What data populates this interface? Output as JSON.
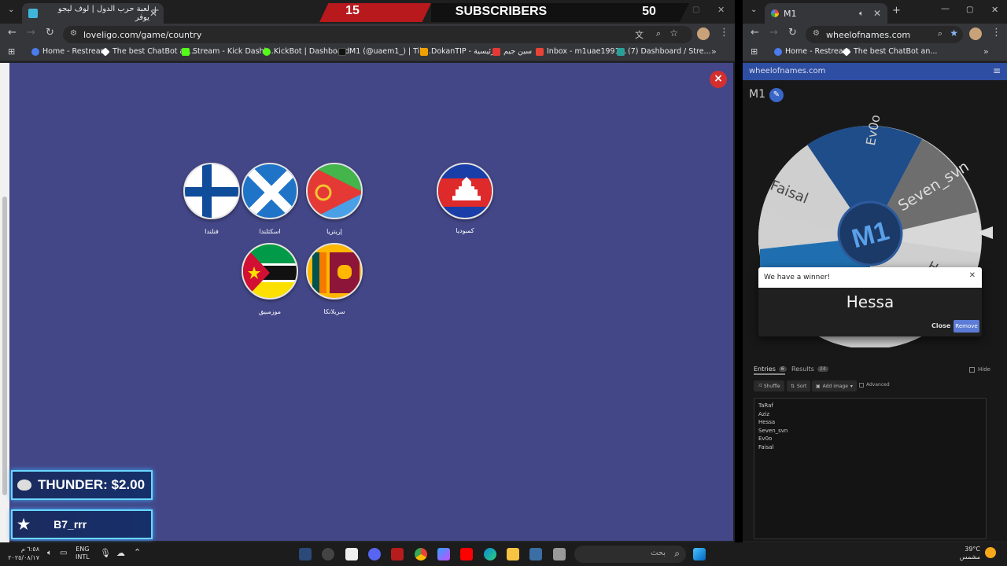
{
  "stream_overlay": {
    "left_count": "15",
    "title": "SUBSCRIBERS",
    "right_count": "50"
  },
  "left_browser": {
    "tab_title": "لعبة حرب الدول | لوف ليجو يوفر",
    "url": "loveligo.com/game/country",
    "bookmarks": [
      {
        "label": "Home - Restream",
        "color": "#4b7bec"
      },
      {
        "label": "The best ChatBot an...",
        "color": "#ffffff"
      },
      {
        "label": "Stream - Kick Dashb...",
        "color": "#53fc18"
      },
      {
        "label": "KickBot | Dashboard",
        "color": "#53fc18"
      },
      {
        "label": "M1 (@uaem1_) | Tik...",
        "color": "#000000"
      },
      {
        "label": "DokanTIP - الرئيسية",
        "color": "#f0a000"
      },
      {
        "label": "سين جيم",
        "color": "#e53935"
      },
      {
        "label": "Inbox - m1uae1991...",
        "color": "#ea4335"
      },
      {
        "label": "(7) Dashboard / Stre...",
        "color": "#2aa198"
      }
    ]
  },
  "game": {
    "close_label": "×",
    "flags": [
      {
        "name": "فنلندا",
        "icon": "finland-flag"
      },
      {
        "name": "اسكتلندا",
        "icon": "scotland-flag"
      },
      {
        "name": "إريتريا",
        "icon": "eritrea-flag"
      },
      {
        "name": "كمبوديا",
        "icon": "cambodia-flag"
      },
      {
        "name": "موزمبيق",
        "icon": "mozambique-flag"
      },
      {
        "name": "سريلانكا",
        "icon": "sri-lanka-flag"
      }
    ]
  },
  "donations": [
    {
      "text": "THUNDER: $2.00",
      "icon": "money-bag-icon"
    },
    {
      "text": "B7_rrr",
      "icon": "star-icon"
    }
  ],
  "right_browser": {
    "tab_title": "M1",
    "url": "wheelofnames.com",
    "bookmarks": [
      "Home - Restream",
      "The best ChatBot an..."
    ],
    "site_label": "wheelofnames.com",
    "wheel_title": "M1",
    "wheel_segments": [
      "Ev0o",
      "Seven_svn",
      "Faisal",
      "H"
    ],
    "winner": {
      "heading": "We have a winner!",
      "name": "Hessa",
      "close_label": "Close",
      "remove_label": "Remove"
    },
    "tabs": {
      "entries_label": "Entries",
      "entries_count": "6",
      "results_label": "Results",
      "results_count": "24",
      "hide_label": "Hide"
    },
    "tools": {
      "shuffle": "Shuffle",
      "sort": "Sort",
      "add_image": "Add image",
      "advanced": "Advanced"
    },
    "entries": [
      "TaRaf",
      "Aziz",
      "Hessa",
      "Seven_svn",
      "Ev0o",
      "Faisal"
    ]
  },
  "taskbar": {
    "date": "٢٠٢٥/٠٨/١٧",
    "time": "٦:٥٨ م",
    "lang_top": "ENG",
    "lang_bottom": "INTL",
    "search_placeholder": "بحث",
    "temp": "39°C",
    "weather": "مشمس"
  }
}
